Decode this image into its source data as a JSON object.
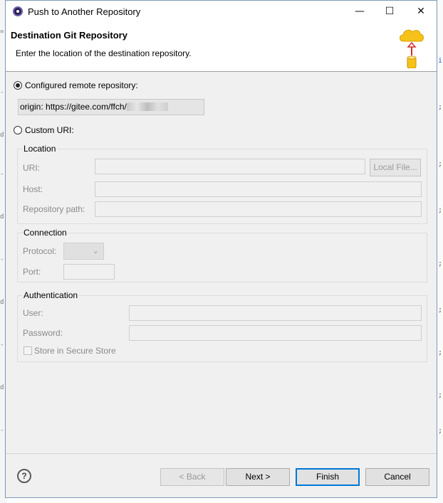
{
  "window": {
    "title": "Push to Another Repository",
    "minimize_glyph": "—",
    "maximize_glyph": "☐",
    "close_glyph": "✕"
  },
  "header": {
    "title": "Destination Git Repository",
    "description": "Enter the location of the destination repository."
  },
  "source": {
    "configured_remote_label": "Configured remote repository:",
    "configured_remote_value": "origin: https://gitee.com/ffch/",
    "custom_uri_label": "Custom URI:",
    "selected": "configured"
  },
  "location": {
    "group_title": "Location",
    "uri_label": "URI:",
    "uri_value": "",
    "local_file_button": "Local File...",
    "host_label": "Host:",
    "host_value": "",
    "repository_path_label": "Repository path:",
    "repository_path_value": ""
  },
  "connection": {
    "group_title": "Connection",
    "protocol_label": "Protocol:",
    "protocol_value": "",
    "port_label": "Port:",
    "port_value": ""
  },
  "authentication": {
    "group_title": "Authentication",
    "user_label": "User:",
    "user_value": "",
    "password_label": "Password:",
    "password_value": "",
    "store_label": "Store in Secure Store",
    "store_checked": false
  },
  "footer": {
    "help_glyph": "?",
    "back_label": "< Back",
    "next_label": "Next >",
    "finish_label": "Finish",
    "cancel_label": "Cancel"
  }
}
